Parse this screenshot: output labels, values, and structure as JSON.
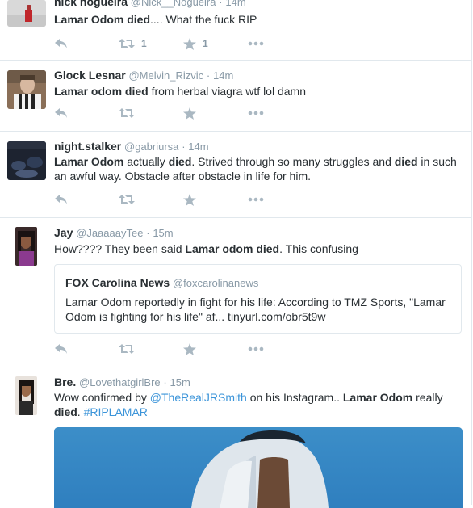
{
  "tweets": [
    {
      "fullname": "nick nogueira",
      "username": "@Nick__Nogueira",
      "time": "14m",
      "text": {
        "b1": "Lamar Odom died",
        "t1": ".... What the fuck RIP"
      },
      "retweets": "1",
      "favorites": "1"
    },
    {
      "fullname": "Glock Lesnar",
      "username": "@Melvin_Rizvic",
      "time": "14m",
      "text": {
        "b1": "Lamar odom died",
        "t1": " from herbal viagra wtf lol damn"
      }
    },
    {
      "fullname": "night.stalker",
      "username": "@gabriursa",
      "time": "14m",
      "text": {
        "b1": "Lamar Odom",
        "t1": " actually ",
        "b2": "died",
        "t2": ". Strived through so many struggles and ",
        "b3": "died",
        "t3": " in such an awful way. Obstacle after obstacle in life for him."
      }
    },
    {
      "fullname": "Jay",
      "username": "@JaaaaayTee",
      "time": "15m",
      "text": {
        "t1": "How???? They been said ",
        "b1": "Lamar odom died",
        "t2": ". This confusing"
      },
      "quote": {
        "name": "FOX Carolina News",
        "handle": "@foxcarolinanews",
        "text": "Lamar Odom reportedly in fight for his life: According to TMZ Sports, \"Lamar Odom is fighting for his life\" af... tinyurl.com/obr5t9w"
      }
    },
    {
      "fullname": "Bre.",
      "username": "@LovethatgirlBre",
      "time": "15m",
      "text": {
        "t1": "Wow confirmed by ",
        "link1": "@TheRealJRSmith",
        "t2": " on his Instagram.. ",
        "b1": "Lamar Odom",
        "t3": " really ",
        "b2": "died",
        "t4": ". ",
        "link2": "#RIPLAMAR"
      }
    }
  ],
  "separator": "·",
  "icons": {
    "reply": "reply-icon",
    "retweet": "retweet-icon",
    "favorite": "star-icon",
    "more": "more-icon"
  },
  "colors": {
    "icon": "#aab8c2",
    "link": "#3b94d9",
    "muted": "#8899a6",
    "text": "#292f33",
    "border": "#e1e8ed"
  }
}
